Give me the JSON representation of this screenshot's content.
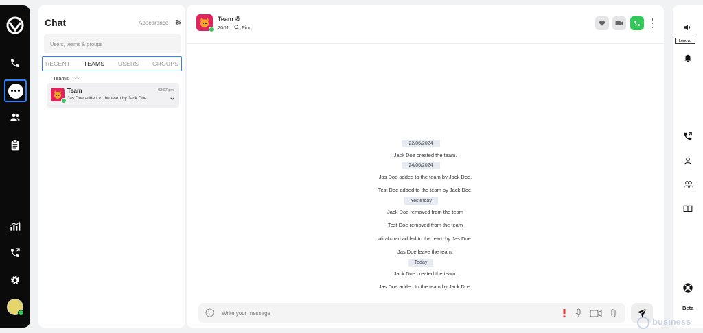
{
  "sidebar": {
    "items": [
      {
        "name": "phone"
      },
      {
        "name": "chat",
        "active": true
      },
      {
        "name": "contacts"
      },
      {
        "name": "notes"
      },
      {
        "name": "analytics"
      },
      {
        "name": "call-forward"
      },
      {
        "name": "settings"
      }
    ]
  },
  "chat_list": {
    "title": "Chat",
    "appearance_label": "Appearance",
    "search_placeholder": "Users, teams & groups",
    "tabs": [
      {
        "label": "RECENT"
      },
      {
        "label": "TEAMS",
        "active": true
      },
      {
        "label": "USERS"
      },
      {
        "label": "GROUPS"
      }
    ],
    "section_label": "Teams",
    "conversations": [
      {
        "name": "Team",
        "time": "02:07 pm",
        "last_message": "Jas Doe added to the team by Jack Doe."
      }
    ]
  },
  "header": {
    "title": "Team",
    "extension": "2001",
    "find_label": "Find"
  },
  "messages": [
    {
      "type": "date",
      "text": "22/06/2024"
    },
    {
      "type": "system",
      "text": "Jack Doe created the team."
    },
    {
      "type": "date",
      "text": "24/06/2024"
    },
    {
      "type": "system",
      "text": "Jas Doe added to the team by Jack Doe."
    },
    {
      "type": "system",
      "text": "Test Doe added to the team by Jack Doe."
    },
    {
      "type": "date",
      "text": "Yesterday"
    },
    {
      "type": "system",
      "text": "Jack Doe removed from the team"
    },
    {
      "type": "system",
      "text": "Test Doe removed from the team"
    },
    {
      "type": "system",
      "text": "ali ahmad added to the team by Jas Doe."
    },
    {
      "type": "system",
      "text": "Jas Doe leave the team."
    },
    {
      "type": "date",
      "text": "Today"
    },
    {
      "type": "system",
      "text": "Jack Doe created the team."
    },
    {
      "type": "system",
      "text": "Jas Doe added to the team by Jack Doe."
    }
  ],
  "composer": {
    "placeholder": "Write your message"
  },
  "right_rail": {
    "lenovo_label": "Lenovo",
    "beta_label": "Beta"
  },
  "watermark": "business",
  "colors": {
    "accent": "#2f80ff",
    "call_green": "#34c759",
    "avatar_pink": "#e0245e",
    "date_pill": "#e6ebf4",
    "alert_red": "#e53935"
  }
}
